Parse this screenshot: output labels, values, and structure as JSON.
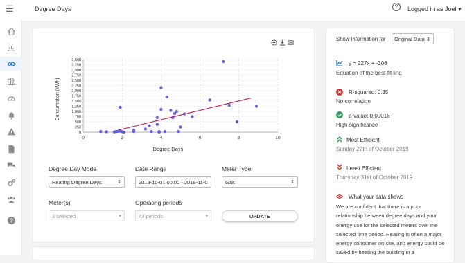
{
  "header": {
    "menu_icon": "hamburger-icon",
    "title": "Degree Days",
    "help_icon": "question-circle-icon",
    "user": "Logged in as Joel"
  },
  "sidebar": {
    "items": [
      {
        "icon": "home-icon"
      },
      {
        "icon": "bar-chart-icon"
      },
      {
        "icon": "eye-icon",
        "active": true
      },
      {
        "icon": "buildings-icon"
      },
      {
        "icon": "gauge-icon"
      },
      {
        "icon": "bell-icon"
      },
      {
        "icon": "warning-icon"
      },
      {
        "icon": "document-icon"
      },
      {
        "icon": "chat-icon"
      },
      {
        "icon": "gears-icon"
      },
      {
        "icon": "users-icon"
      },
      {
        "icon": "help-icon"
      }
    ]
  },
  "chart_tools": [
    "zoom-icon",
    "download-icon",
    "image-icon"
  ],
  "chart_data": {
    "type": "scatter",
    "xlabel": "Degree Days",
    "ylabel": "Consumption (kWh)",
    "xlim": [
      0,
      10
    ],
    "ylim": [
      0,
      3500
    ],
    "x_ticks": [
      "0",
      "2",
      "4",
      "6",
      "8",
      "10"
    ],
    "y_ticks": [
      "0",
      "250",
      "500",
      "750",
      "1,000",
      "1,250",
      "1,500",
      "1,750",
      "2,000",
      "2,250",
      "2,500",
      "2,750",
      "3,000",
      "3,250",
      "3,500"
    ],
    "grid": true,
    "points": [
      [
        0.9,
        30
      ],
      [
        1.2,
        20
      ],
      [
        1.6,
        10
      ],
      [
        1.7,
        30
      ],
      [
        1.8,
        40
      ],
      [
        1.9,
        50
      ],
      [
        2.0,
        20
      ],
      [
        1.9,
        1200
      ],
      [
        2.1,
        0
      ],
      [
        2.6,
        30
      ],
      [
        2.6,
        100
      ],
      [
        3.2,
        150
      ],
      [
        3.4,
        300
      ],
      [
        3.5,
        30
      ],
      [
        3.8,
        380
      ],
      [
        3.8,
        700
      ],
      [
        3.9,
        30
      ],
      [
        3.9,
        0
      ],
      [
        4.0,
        2150
      ],
      [
        4.0,
        1100
      ],
      [
        4.2,
        30
      ],
      [
        4.3,
        1700
      ],
      [
        4.5,
        1050
      ],
      [
        4.6,
        700
      ],
      [
        4.7,
        900
      ],
      [
        4.8,
        1000
      ],
      [
        4.9,
        30
      ],
      [
        5.0,
        250
      ],
      [
        5.2,
        880
      ],
      [
        5.6,
        750
      ],
      [
        6.5,
        1550
      ],
      [
        7.2,
        3400
      ],
      [
        7.5,
        1300
      ],
      [
        7.9,
        500
      ],
      [
        8.9,
        1250
      ]
    ],
    "trendline": {
      "slope": 227,
      "intercept": -308,
      "x_range": [
        1.8,
        8.6
      ],
      "color": "#c2185b"
    },
    "point_color": "#5b4fd6"
  },
  "controls": {
    "degree_day_mode": {
      "label": "Degree Day Mode",
      "value": "Heating Degree Days"
    },
    "date_range": {
      "label": "Date Range",
      "value": "2019-10-01 00:00 - 2019-11-0"
    },
    "meter_type": {
      "label": "Meter Type",
      "value": "Gas"
    },
    "meters": {
      "label": "Meter(s)",
      "value": "3 selected"
    },
    "operating_periods": {
      "label": "Operating periods",
      "value": "All periods"
    },
    "update_label": "UPDATE"
  },
  "side": {
    "show_label": "Show information for",
    "show_value": "Original Data",
    "equation": "y = 227x + -308",
    "equation_sub": "Equation of the best-fit line",
    "r2": "R-squared: 0.35",
    "r2_sub": "No correlation",
    "pvalue": "p-value: 0.00016",
    "pvalue_sub": "High significance",
    "most_eff": "Most Efficient",
    "most_eff_sub": "Sunday 27th of October 2019",
    "least_eff": "Least Efficient",
    "least_eff_sub": "Thursday 31st of October 2019",
    "shows": "What your data shows",
    "shows_text": "We are confident that there is a poor relationship between degree days and your energy use for the selected meters over the selected time period. Heating is often a major energy consumer on site, and energy could be saved by heating the building in a",
    "colors": {
      "blue": "#2d7fd3",
      "red": "#d9302b",
      "green": "#2e9e5b",
      "chevron_red": "#d9302b"
    }
  }
}
